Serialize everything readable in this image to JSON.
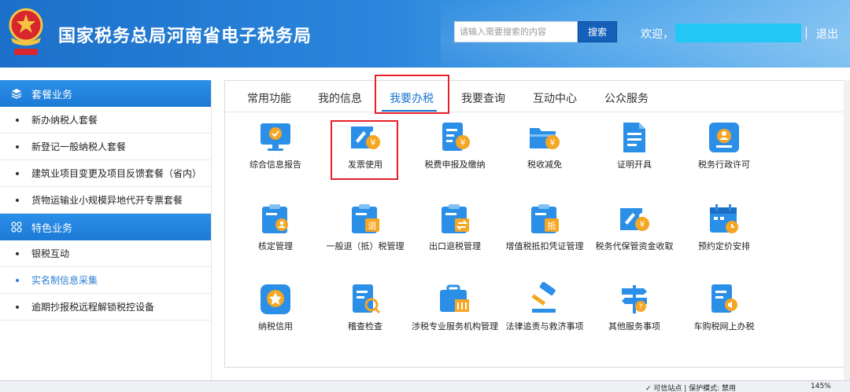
{
  "header": {
    "site_title": "国家税务总局河南省电子税务局",
    "search_placeholder": "请输入需要搜索的内容",
    "search_button": "搜索",
    "welcome": "欢迎，",
    "logout": "退出"
  },
  "sidebar": {
    "sections": [
      {
        "title": "套餐业务",
        "icon": "layers-icon",
        "items": [
          {
            "label": "新办纳税人套餐"
          },
          {
            "label": "新登记一般纳税人套餐"
          },
          {
            "label": "建筑业项目变更及项目反馈套餐（省内）"
          },
          {
            "label": "货物运输业小规模异地代开专票套餐"
          }
        ]
      },
      {
        "title": "特色业务",
        "icon": "grid-icon",
        "items": [
          {
            "label": "银税互动"
          },
          {
            "label": "实名制信息采集"
          },
          {
            "label": "逾期抄报税远程解锁税控设备"
          }
        ]
      }
    ],
    "active_item": "实名制信息采集"
  },
  "tabs": [
    {
      "label": "常用功能"
    },
    {
      "label": "我的信息"
    },
    {
      "label": "我要办税"
    },
    {
      "label": "我要查询"
    },
    {
      "label": "互动中心"
    },
    {
      "label": "公众服务"
    }
  ],
  "active_tab": "我要办税",
  "tiles": [
    {
      "label": "综合信息报告",
      "icon": "monitor-check-icon"
    },
    {
      "label": "发票使用",
      "icon": "invoice-yen-icon"
    },
    {
      "label": "税费申报及缴纳",
      "icon": "document-yen-icon"
    },
    {
      "label": "税收减免",
      "icon": "folder-yen-icon"
    },
    {
      "label": "证明开具",
      "icon": "certificate-icon"
    },
    {
      "label": "税务行政许可",
      "icon": "user-card-icon"
    },
    {
      "label": "核定管理",
      "icon": "clipboard-user-icon"
    },
    {
      "label": "一般退（抵）税管理",
      "icon": "clipboard-refund-icon"
    },
    {
      "label": "出口退税管理",
      "icon": "clipboard-export-icon"
    },
    {
      "label": "增值税抵扣凭证管理",
      "icon": "clipboard-deduct-icon"
    },
    {
      "label": "税务代保管资金收取",
      "icon": "ticket-yen-icon"
    },
    {
      "label": "预约定价安排",
      "icon": "calendar-clock-icon"
    },
    {
      "label": "纳税信用",
      "icon": "star-badge-icon"
    },
    {
      "label": "稽查检查",
      "icon": "document-search-icon"
    },
    {
      "label": "涉税专业服务机构管理",
      "icon": "briefcase-building-icon"
    },
    {
      "label": "法律追责与救济事项",
      "icon": "gavel-icon"
    },
    {
      "label": "其他服务事项",
      "icon": "signpost-icon"
    },
    {
      "label": "车购税网上办税",
      "icon": "document-sound-icon"
    }
  ],
  "statusbar": {
    "trusted": "✓ 可信站点 | 保护模式: 禁用",
    "zoom": "145%"
  },
  "colors": {
    "primary": "#1a73d1",
    "highlight": "#e8202a",
    "icon_blue": "#2b8fe8",
    "icon_orange": "#f5a623"
  }
}
